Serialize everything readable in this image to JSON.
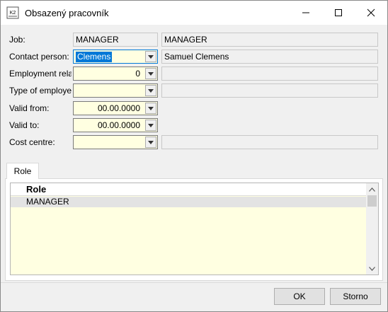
{
  "window": {
    "title": "Obsazený pracovník",
    "app_icon_text": "K2"
  },
  "form": {
    "job": {
      "label": "Job:",
      "code": "MANAGER",
      "name": "MANAGER"
    },
    "contact_person": {
      "label": "Contact person:",
      "value": "Clemens",
      "name": "Samuel Clemens"
    },
    "employment_relation": {
      "label": "Employment relatio",
      "value": "0",
      "name": ""
    },
    "type_of_employee": {
      "label": "Type of employee:",
      "value": "",
      "name": ""
    },
    "valid_from": {
      "label": "Valid from:",
      "value": "00.00.0000"
    },
    "valid_to": {
      "label": "Valid to:",
      "value": "00.00.0000"
    },
    "cost_centre": {
      "label": "Cost centre:",
      "value": "",
      "name": ""
    }
  },
  "tabs": [
    {
      "label": "Role"
    }
  ],
  "grid": {
    "columns": [
      "Role"
    ],
    "rows": [
      {
        "role": "MANAGER"
      }
    ]
  },
  "buttons": {
    "ok": "OK",
    "cancel": "Storno"
  },
  "icons": {
    "minimize": "minimize-icon",
    "maximize": "maximize-icon",
    "close": "close-icon",
    "dropdown": "chevron-down-icon",
    "scroll_up": "scroll-up-icon",
    "scroll_down": "scroll-down-icon"
  },
  "colors": {
    "edit_field": "#ffffe1",
    "readonly_field": "#f0f0f0",
    "selection": "#0078d7"
  }
}
